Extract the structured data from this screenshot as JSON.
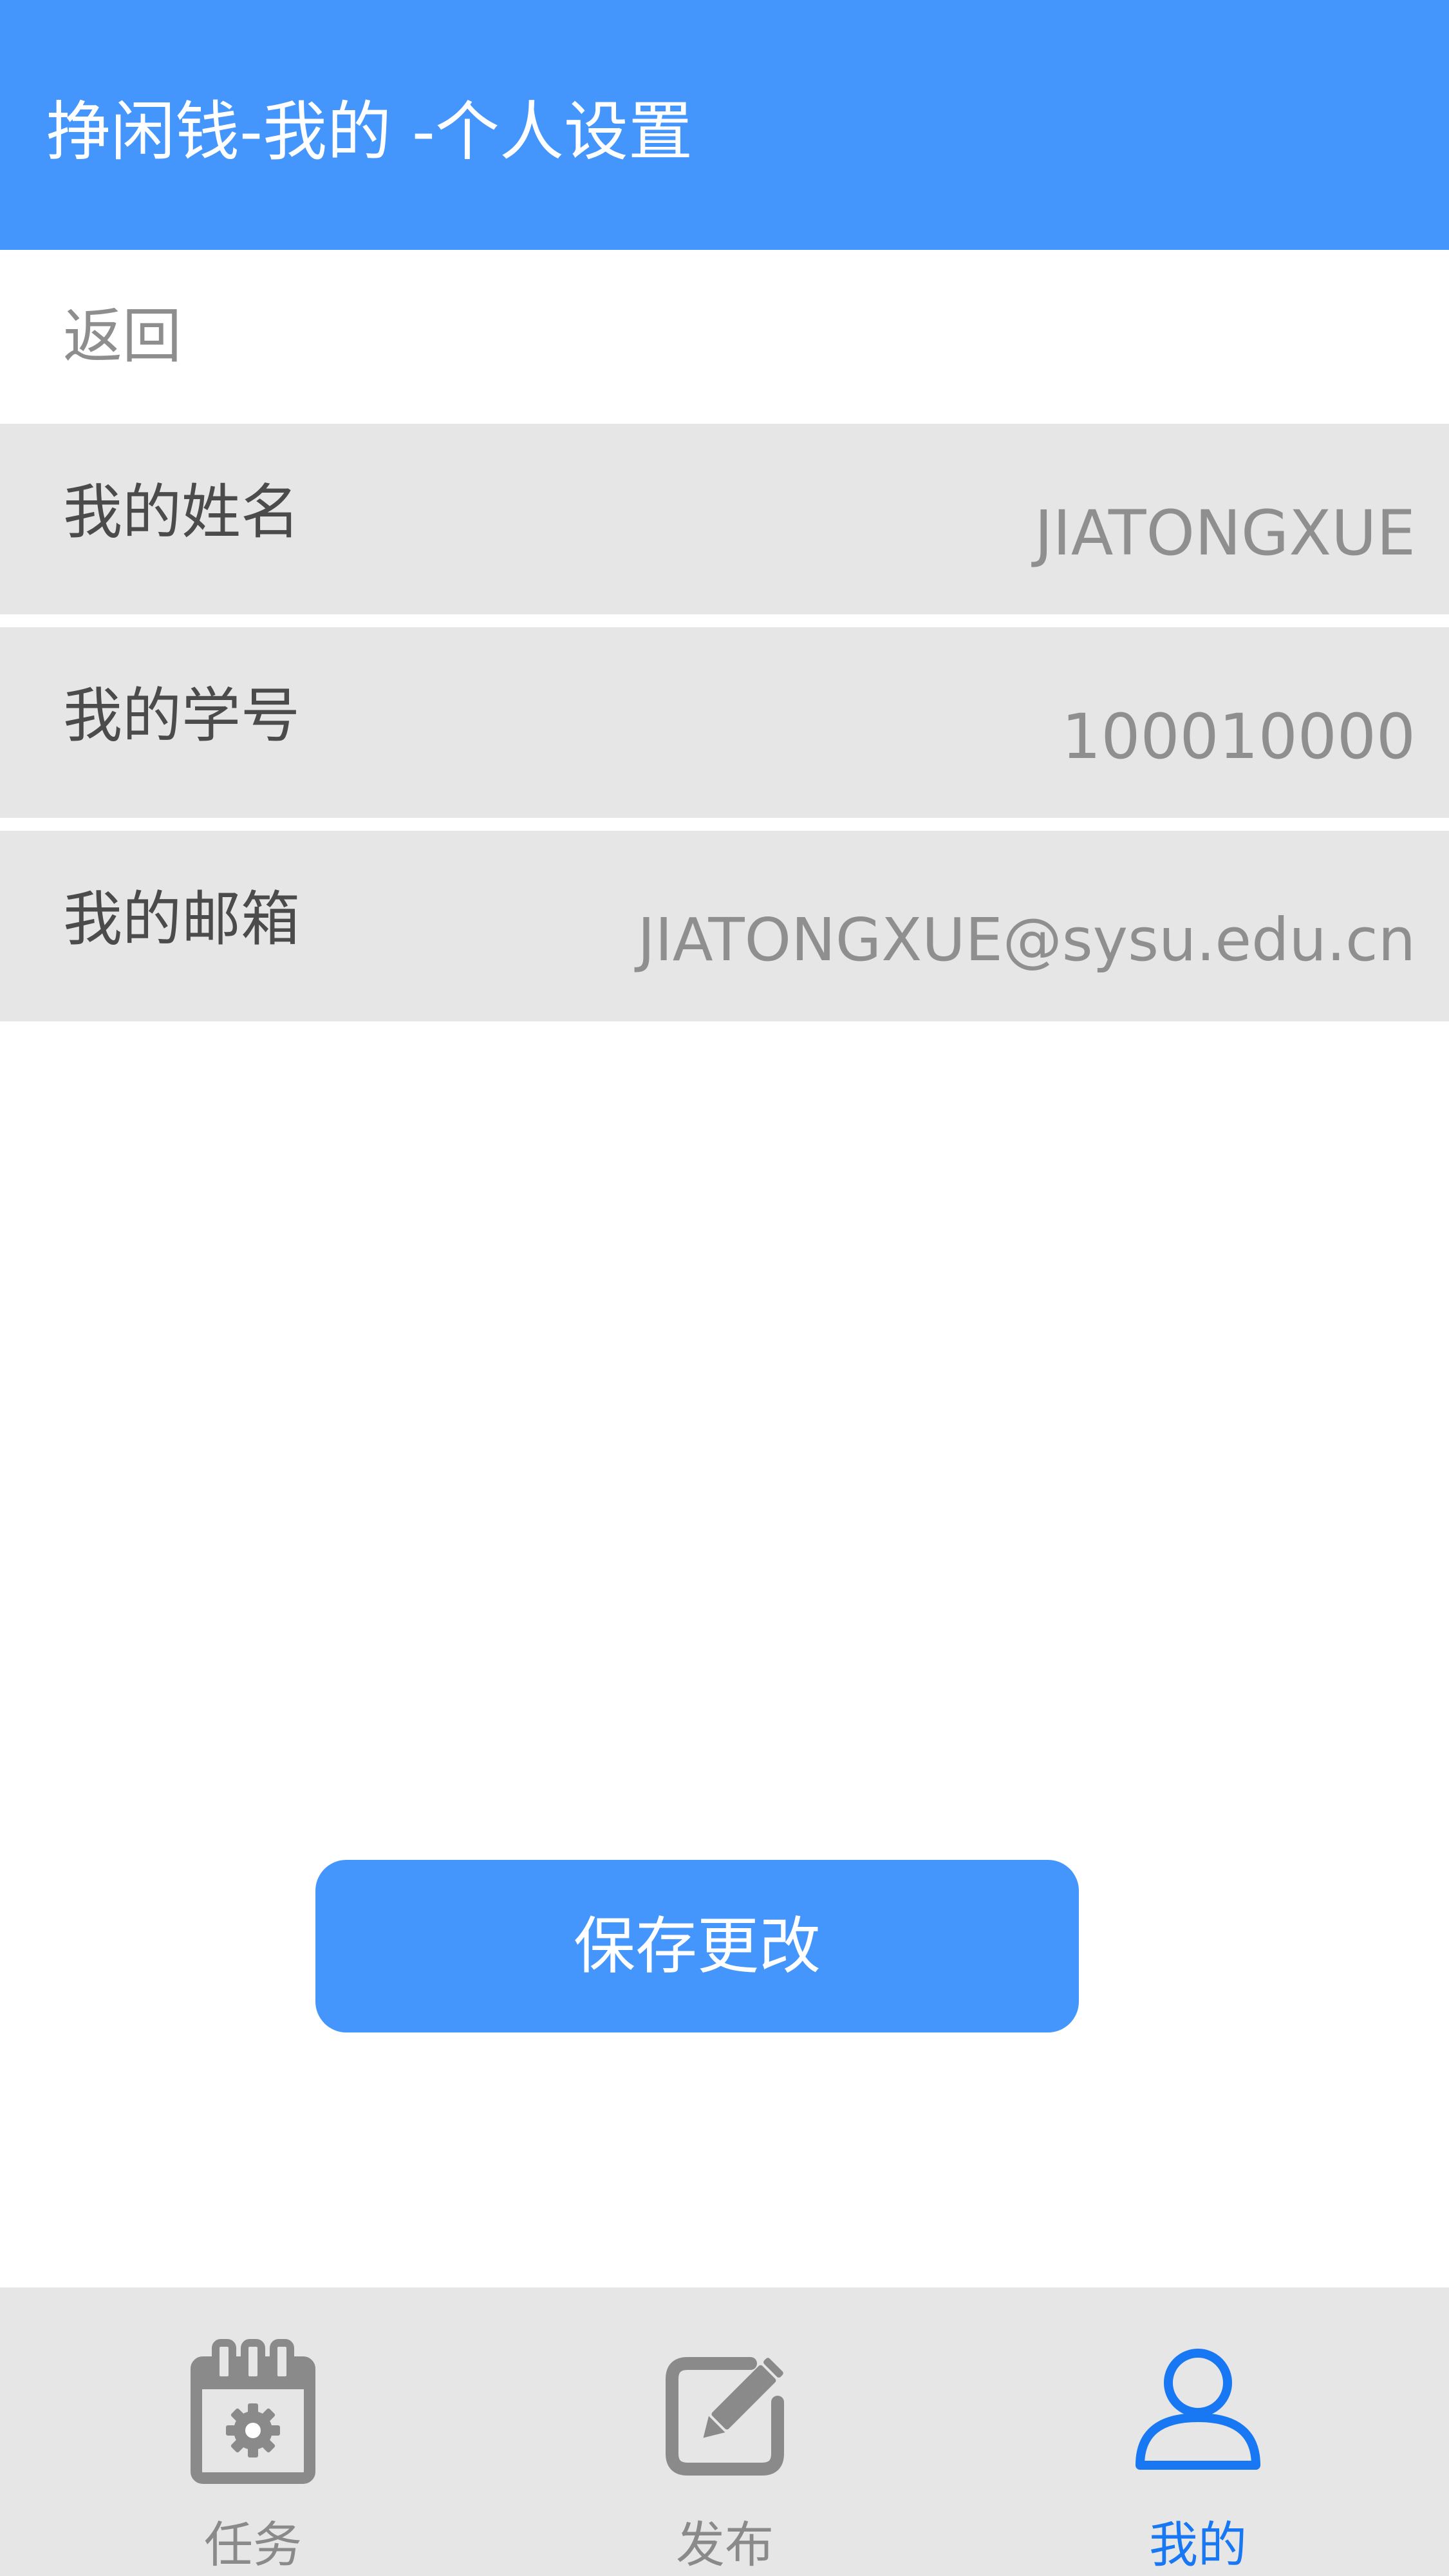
{
  "header": {
    "title": "挣闲钱-我的 -个人设置"
  },
  "back": {
    "label": "返回"
  },
  "profile": {
    "fields": [
      {
        "label": "我的姓名",
        "value": "JIATONGXUE"
      },
      {
        "label": "我的学号",
        "value": "100010000"
      },
      {
        "label": "我的邮箱",
        "value": "JIATONGXUE@sysu.edu.cn"
      }
    ]
  },
  "actions": {
    "save_label": "保存更改"
  },
  "tabbar": {
    "items": [
      {
        "label": "任务",
        "icon": "calendar-gear-icon",
        "active": false
      },
      {
        "label": "发布",
        "icon": "edit-pencil-icon",
        "active": false
      },
      {
        "label": "我的",
        "icon": "user-icon",
        "active": true
      }
    ]
  },
  "colors": {
    "primary": "#4496fd",
    "active_tab": "#1877f2",
    "row_background": "#e6e6e6",
    "label_text": "#4b4b4b",
    "value_text": "#8f8f8f"
  }
}
